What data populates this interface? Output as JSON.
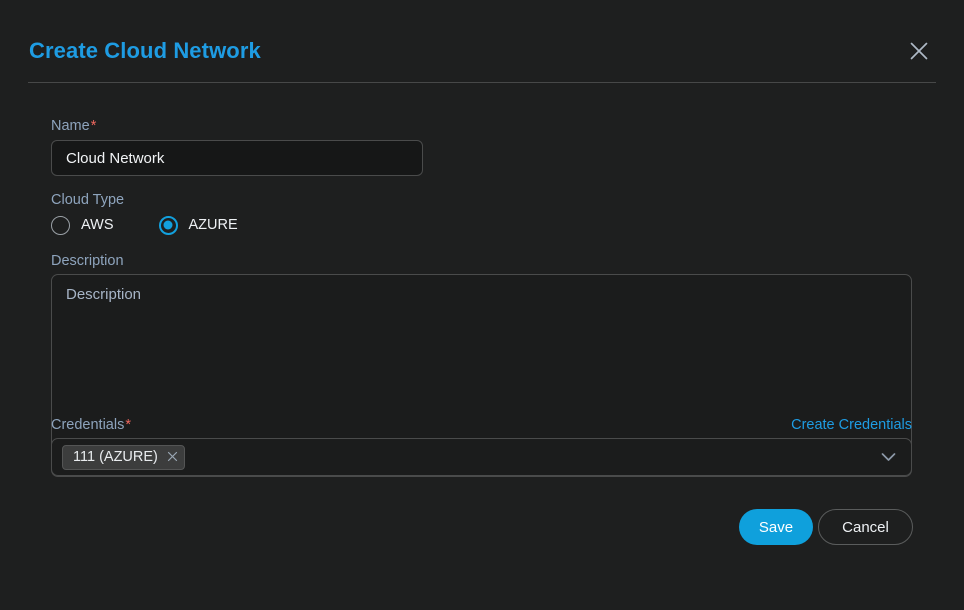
{
  "dialog": {
    "title": "Create Cloud Network",
    "close_icon": "close-icon"
  },
  "form": {
    "name": {
      "label": "Name",
      "required_marker": "*",
      "value": "Cloud Network",
      "placeholder": "Name"
    },
    "cloud_type": {
      "label": "Cloud Type",
      "options": [
        {
          "label": "AWS",
          "selected": false
        },
        {
          "label": "AZURE",
          "selected": true
        }
      ]
    },
    "description": {
      "label": "Description",
      "value": "",
      "placeholder": "Description"
    },
    "credentials": {
      "label": "Credentials",
      "required_marker": "*",
      "create_link": "Create Credentials",
      "selected_chips": [
        {
          "label": "111 (AZURE)",
          "remove_icon": "close-icon"
        }
      ],
      "chevron_icon": "chevron-down-icon"
    }
  },
  "footer": {
    "save_label": "Save",
    "cancel_label": "Cancel"
  },
  "colors": {
    "background": "#1e1f1f",
    "accent_blue": "#1e9ce3",
    "save_blue": "#0fa0dc",
    "label_blue_gray": "#8ea4bd",
    "required_red": "#f0685f",
    "border_gray": "#4a4b4b"
  }
}
